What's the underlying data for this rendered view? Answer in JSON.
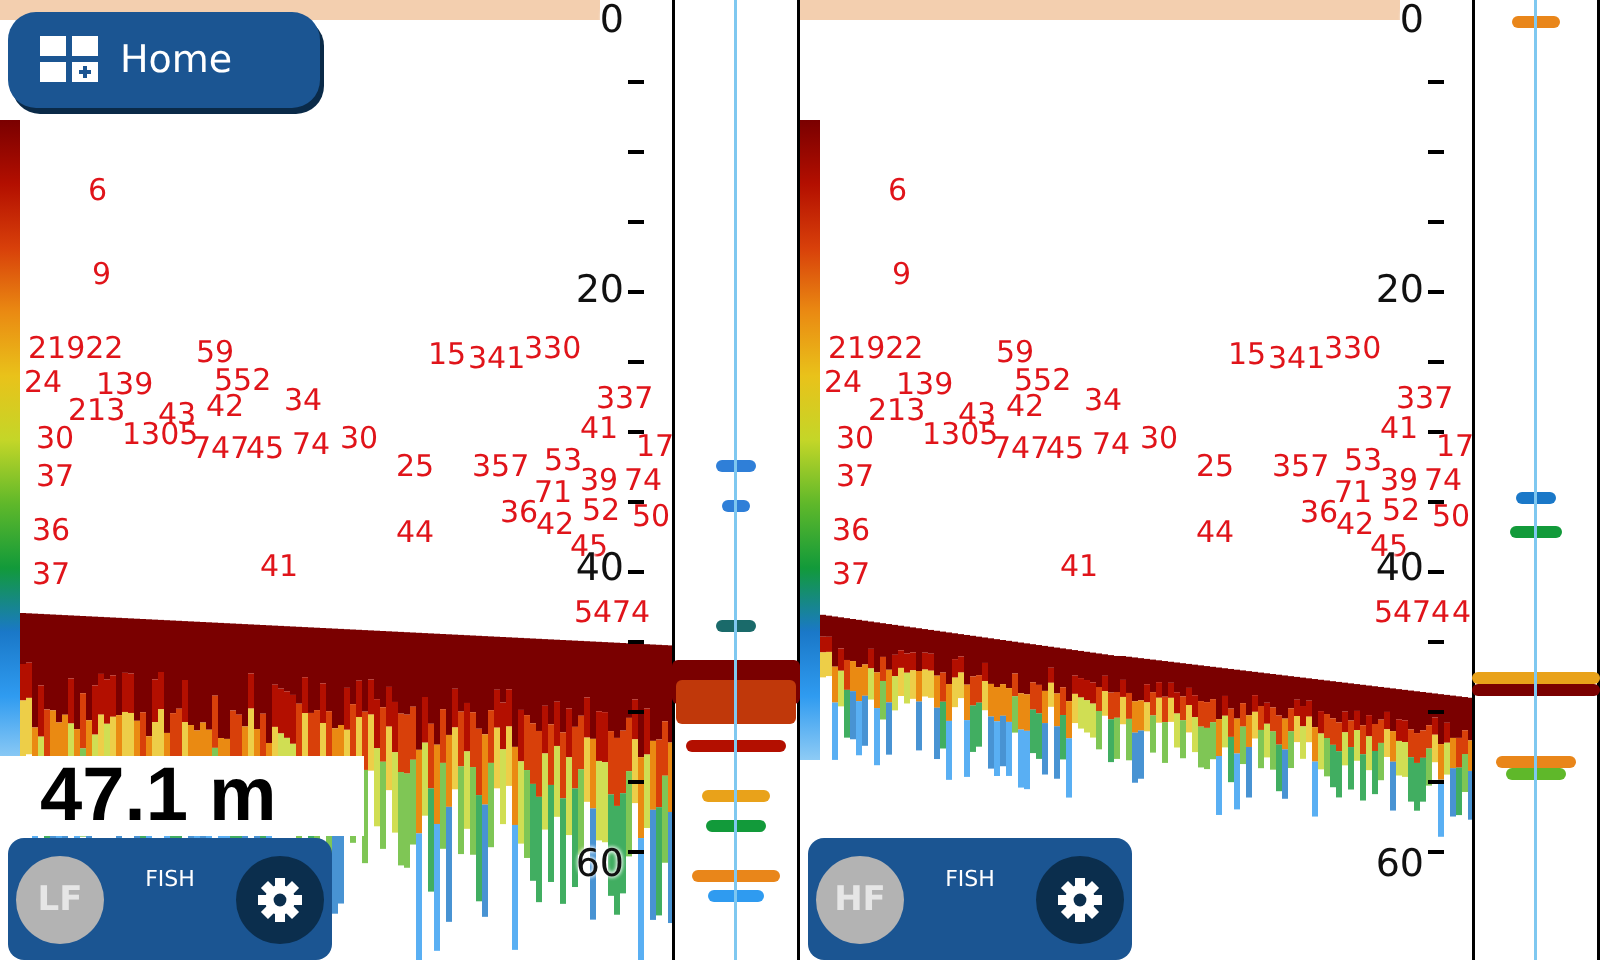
{
  "home_button": {
    "label": "Home"
  },
  "panels": [
    {
      "frequency": "LF",
      "mode": "FISH",
      "depth_reading": "47.1 m",
      "scale": [
        "0",
        "20",
        "40",
        "60"
      ],
      "fish": [
        "6",
        "9",
        "21922",
        "59",
        "15",
        "341",
        "330",
        "24",
        "139",
        "552",
        "213",
        "43",
        "42",
        "34",
        "337",
        "30",
        "1305",
        "747",
        "45",
        "74",
        "30",
        "41",
        "17",
        "37",
        "25",
        "357",
        "53",
        "39",
        "74",
        "36",
        "71",
        "52",
        "50",
        "36",
        "44",
        "42",
        "45",
        "37",
        "41",
        "54",
        "74"
      ]
    },
    {
      "frequency": "HF",
      "mode": "FISH",
      "scale": [
        "0",
        "20",
        "40",
        "60"
      ],
      "fish": [
        "6",
        "9",
        "21922",
        "59",
        "15",
        "341",
        "330",
        "24",
        "139",
        "552",
        "213",
        "43",
        "42",
        "34",
        "337",
        "30",
        "1305",
        "747",
        "45",
        "74",
        "30",
        "41",
        "17",
        "37",
        "25",
        "357",
        "53",
        "39",
        "74",
        "36",
        "71",
        "52",
        "50",
        "36",
        "44",
        "42",
        "45",
        "37",
        "41",
        "54",
        "74",
        "4"
      ]
    }
  ]
}
